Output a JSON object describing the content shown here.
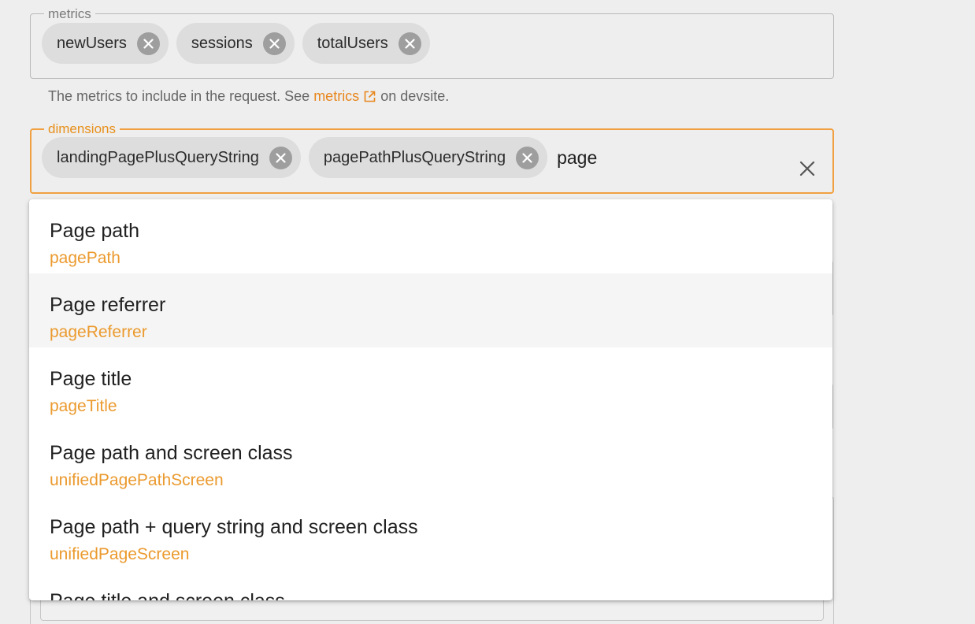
{
  "metrics": {
    "legend": "metrics",
    "chips": [
      {
        "label": "newUsers"
      },
      {
        "label": "sessions"
      },
      {
        "label": "totalUsers"
      }
    ],
    "helper_prefix": "The metrics to include in the request. See",
    "helper_link": "metrics",
    "helper_suffix": "on devsite."
  },
  "dimensions": {
    "legend": "dimensions",
    "chips": [
      {
        "label": "landingPagePlusQueryString"
      },
      {
        "label": "pagePathPlusQueryString"
      }
    ],
    "input_value": "page"
  },
  "options": [
    {
      "name": "Page path",
      "id": "pagePath"
    },
    {
      "name": "Page referrer",
      "id": "pageReferrer"
    },
    {
      "name": "Page title",
      "id": "pageTitle"
    },
    {
      "name": "Page path and screen class",
      "id": "unifiedPagePathScreen"
    },
    {
      "name": "Page path + query string and screen class",
      "id": "unifiedPageScreen"
    },
    {
      "name": "Page title and screen class",
      "id": ""
    }
  ],
  "colors": {
    "accent": "#e8901c",
    "focus_border": "#f0a040",
    "chip_bg": "#dddddd"
  },
  "icons": {
    "chip_remove": "cancel-circle-icon",
    "clear": "close-icon",
    "external": "open-in-new-icon"
  }
}
